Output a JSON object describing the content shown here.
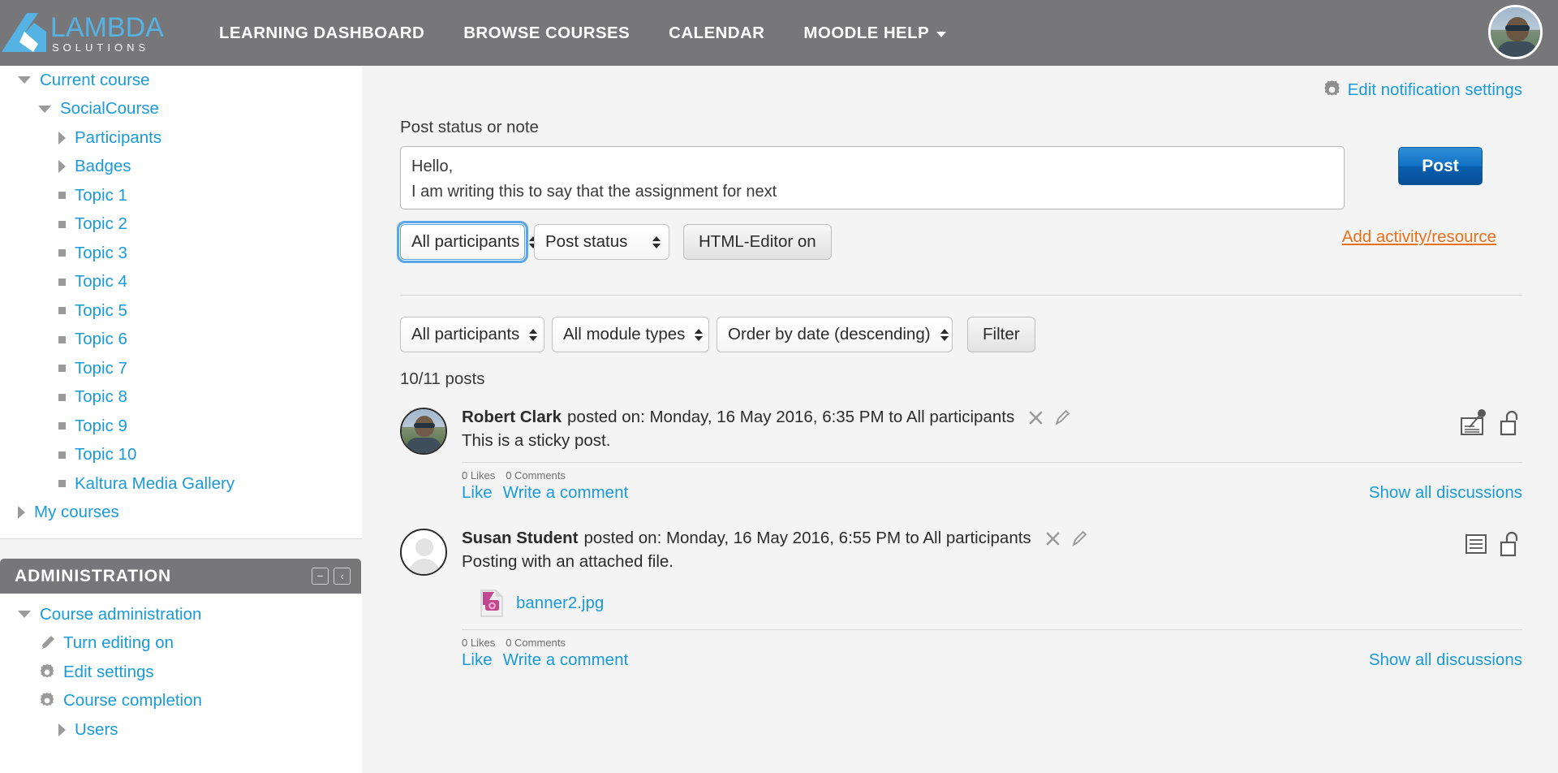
{
  "navbar": {
    "brand": {
      "name": "LAMBDA",
      "tagline": "SOLUTIONS",
      "logo_color": "#55b3e3"
    },
    "links": [
      {
        "label": "LEARNING DASHBOARD",
        "icon": "",
        "has_caret": false
      },
      {
        "label": "BROWSE COURSES",
        "icon": "",
        "has_caret": false
      },
      {
        "label": "CALENDAR",
        "icon": "",
        "has_caret": false
      },
      {
        "label": "MOODLE HELP",
        "icon": "chevron-down-icon",
        "has_caret": true
      }
    ],
    "avatar": "user-avatar",
    "background": "#77777a"
  },
  "sidebar": {
    "nav_items": [
      {
        "label": "Current course",
        "marker": "tri-down",
        "indent": 0
      },
      {
        "label": "SocialCourse",
        "marker": "tri-down",
        "indent": 1
      },
      {
        "label": "Participants",
        "marker": "tri-right",
        "indent": 2
      },
      {
        "label": "Badges",
        "marker": "tri-right",
        "indent": 2
      },
      {
        "label": "Topic 1",
        "marker": "square",
        "indent": 2
      },
      {
        "label": "Topic 2",
        "marker": "square",
        "indent": 2
      },
      {
        "label": "Topic 3",
        "marker": "square",
        "indent": 2
      },
      {
        "label": "Topic 4",
        "marker": "square",
        "indent": 2
      },
      {
        "label": "Topic 5",
        "marker": "square",
        "indent": 2
      },
      {
        "label": "Topic 6",
        "marker": "square",
        "indent": 2
      },
      {
        "label": "Topic 7",
        "marker": "square",
        "indent": 2
      },
      {
        "label": "Topic 8",
        "marker": "square",
        "indent": 2
      },
      {
        "label": "Topic 9",
        "marker": "square",
        "indent": 2
      },
      {
        "label": "Topic 10",
        "marker": "square",
        "indent": 2
      },
      {
        "label": "Kaltura Media Gallery",
        "marker": "square",
        "indent": 1
      },
      {
        "label": "My courses",
        "marker": "tri-right",
        "indent": 0
      }
    ],
    "administration": {
      "title": "ADMINISTRATION",
      "dock_label": "−",
      "collapse_label": "‹",
      "items": [
        {
          "label": "Course administration",
          "marker": "tri-down",
          "indent": 0
        },
        {
          "label": "Turn editing on",
          "marker": "pencil-icon",
          "indent": 1
        },
        {
          "label": "Edit settings",
          "marker": "gear-icon",
          "indent": 1
        },
        {
          "label": "Course completion",
          "marker": "gear-icon",
          "indent": 1
        },
        {
          "label": "Users",
          "marker": "tri-right",
          "indent": 1
        }
      ]
    },
    "link_color": "#1a9ad8"
  },
  "main": {
    "edit_notification_settings": {
      "label": "Edit notification settings",
      "icon": "gear-icon"
    },
    "composer": {
      "label": "Post status or note",
      "text_value": "Hello,\nI am writing this to say that the assignment for next",
      "placeholder": "",
      "post_button": "Post",
      "audience_select": "All participants",
      "type_select": "Post status",
      "editor_toggle": "HTML-Editor on",
      "add_activity_link": "Add activity/resource"
    },
    "filterbar": {
      "participants_select": "All participants",
      "module_select": "All module types",
      "order_select": "Order by date (descending)",
      "filter_button": "Filter",
      "posts_count": "10/11 posts"
    },
    "posts": [
      {
        "author": "Robert Clark",
        "meta_text": "posted on: Monday, 16 May 2016, 6:35 PM to All participants",
        "body": "This is a sticky post.",
        "avatar_type": "photo",
        "likes": "0 Likes",
        "comments": "0 Comments",
        "like_label": "Like",
        "comment_label": "Write a comment",
        "show_all_label": "Show all discussions",
        "delete_icon": "close-icon",
        "edit_icon": "pencil-icon",
        "right_icons": [
          "sticky-note-icon",
          "unlock-icon"
        ],
        "attachment": null
      },
      {
        "author": "Susan Student",
        "meta_text": "posted on: Monday, 16 May 2016, 6:55 PM to All participants",
        "body": "Posting with an attached file.",
        "avatar_type": "blank",
        "likes": "0 Likes",
        "comments": "0 Comments",
        "like_label": "Like",
        "comment_label": "Write a comment",
        "show_all_label": "Show all discussions",
        "delete_icon": "close-icon",
        "edit_icon": "pencil-icon",
        "right_icons": [
          "list-icon",
          "unlock-icon"
        ],
        "attachment": {
          "filename": "banner2.jpg",
          "icon": "image-file-icon"
        }
      }
    ],
    "accent_link": "#1a9ad8",
    "accent_orange": "#e8701a"
  }
}
